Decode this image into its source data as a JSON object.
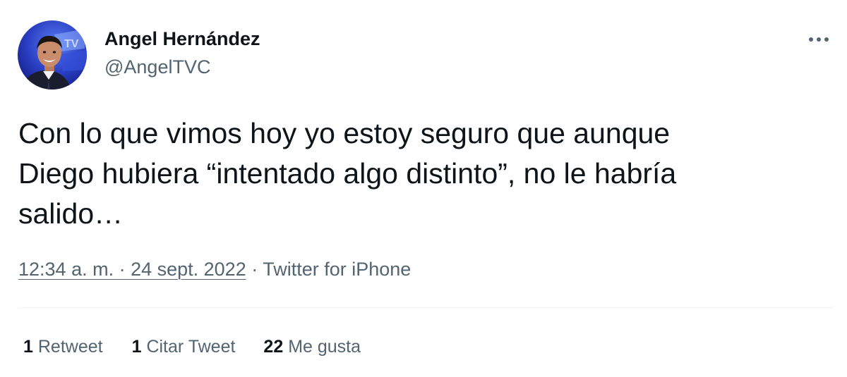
{
  "author": {
    "display_name": "Angel Hernández",
    "handle": "@AngelTVC"
  },
  "tweet": {
    "text": "Con lo que vimos hoy yo estoy seguro que aunque\nDiego hubiera “intentado algo distinto”, no le habría\nsalido…",
    "timestamp": "12:34 a. m. · 24 sept. 2022",
    "separator": " · ",
    "source": "Twitter for iPhone"
  },
  "stats": {
    "retweets_count": "1",
    "retweets_label": "Retweet",
    "quotes_count": "1",
    "quotes_label": "Citar Tweet",
    "likes_count": "22",
    "likes_label": "Me gusta"
  },
  "icons": {
    "more": "more-horizontal-icon"
  },
  "colors": {
    "text_primary": "#0f1419",
    "text_secondary": "#536471",
    "divider": "#eff3f4"
  }
}
